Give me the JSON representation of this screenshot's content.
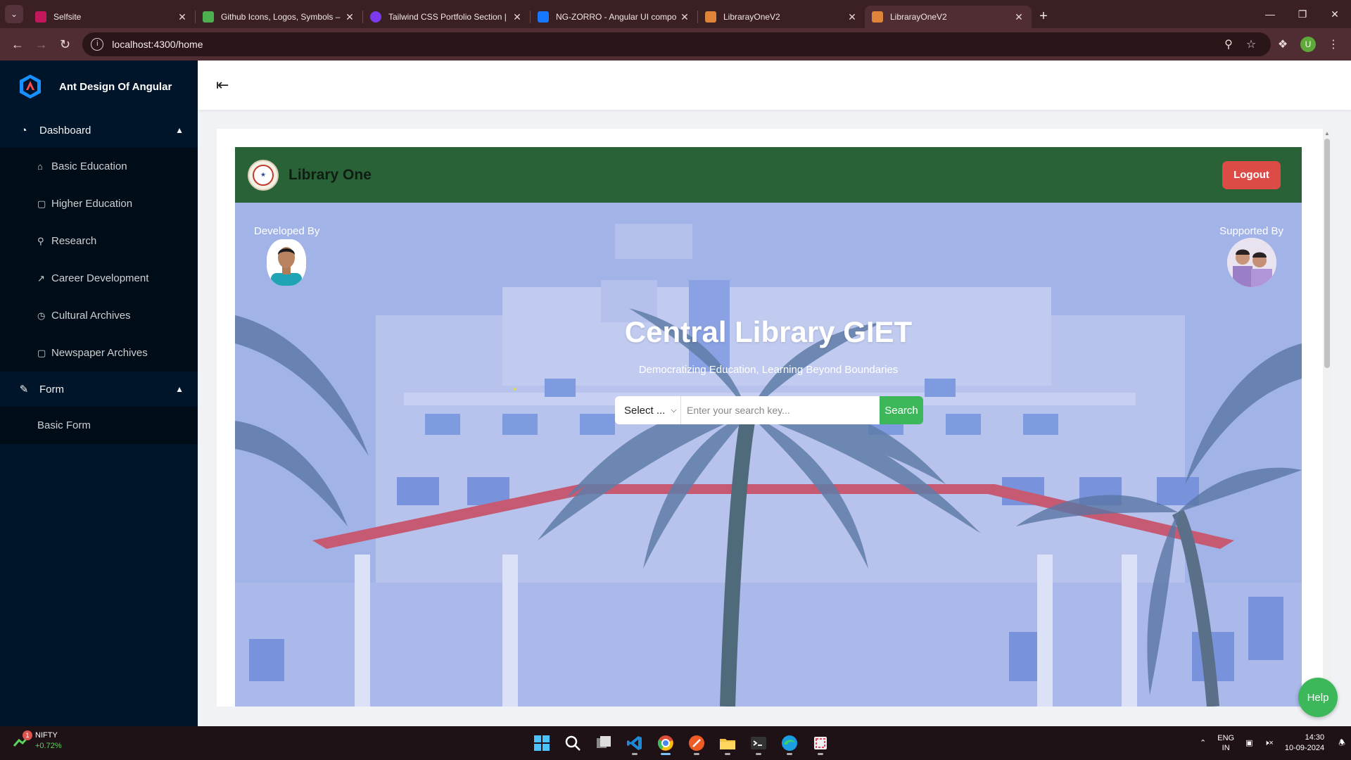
{
  "browser": {
    "tabs": [
      {
        "title": "Selfsite",
        "fav_color": "#c2185b"
      },
      {
        "title": "Github Icons, Logos, Symbols –",
        "fav_color": "#4caf50"
      },
      {
        "title": "Tailwind CSS Portfolio Section |",
        "fav_color": "#7c3aed"
      },
      {
        "title": "NG-ZORRO - Angular UI compo",
        "fav_color": "#1677ff"
      },
      {
        "title": "LibrarayOneV2",
        "fav_color": "#e0843a"
      },
      {
        "title": "LibrarayOneV2",
        "fav_color": "#e0843a"
      }
    ],
    "url": "localhost:4300/home",
    "profile_initial": "U"
  },
  "sidebar": {
    "brand": "Ant Design Of Angular",
    "sections": [
      {
        "title": "Dashboard",
        "items": [
          {
            "label": "Basic Education",
            "icon": "home-icon"
          },
          {
            "label": "Higher Education",
            "icon": "file-icon"
          },
          {
            "label": "Research",
            "icon": "search-icon"
          },
          {
            "label": "Career Development",
            "icon": "line-chart-icon"
          },
          {
            "label": "Cultural Archives",
            "icon": "history-icon"
          },
          {
            "label": "Newspaper Archives",
            "icon": "file-icon"
          }
        ]
      },
      {
        "title": "Form",
        "items": [
          {
            "label": "Basic Form"
          }
        ]
      }
    ]
  },
  "library": {
    "title": "Library One",
    "logout_label": "Logout",
    "developed_by": "Developed By",
    "supported_by": "Supported By",
    "hero_title": "Central Library GIET",
    "hero_subtitle": "Democratizing Education, Learning Beyond Boundaries",
    "select_label": "Select ...",
    "search_placeholder": "Enter your search key...",
    "search_button": "Search",
    "help_label": "Help"
  },
  "taskbar": {
    "widget_name": "NIFTY",
    "widget_change": "+0.72%",
    "widget_badge": "1",
    "lang_line1": "ENG",
    "lang_line2": "IN",
    "time": "14:30",
    "date": "10-09-2024"
  },
  "colors": {
    "sidebar_bg": "#001529",
    "library_header": "#2a6238",
    "logout": "#dc4b45",
    "search_button": "#3cb85b"
  }
}
